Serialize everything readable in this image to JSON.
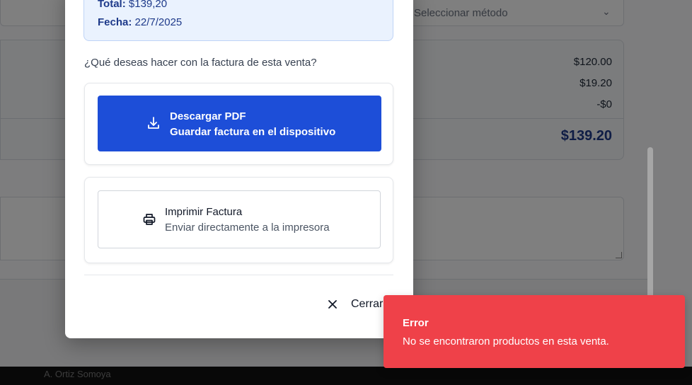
{
  "background": {
    "payment_select_placeholder": "Seleccionar método",
    "summary_rows": [
      "$120.00",
      "$19.20",
      "-$0"
    ],
    "summary_total": "$139.20",
    "footer_text": "A. Ortiz Somoya"
  },
  "modal": {
    "total_label": "Total:",
    "total_value": "$139,20",
    "date_label": "Fecha:",
    "date_value": "22/7/2025",
    "question": "¿Qué deseas hacer con la factura de esta venta?",
    "download": {
      "title": "Descargar PDF",
      "subtitle": "Guardar factura en el dispositivo",
      "icon": "download-icon"
    },
    "print": {
      "title": "Imprimir Factura",
      "subtitle": "Enviar directamente a la impresora",
      "icon": "printer-icon"
    },
    "close_label": "Cerrar",
    "close_icon": "close-icon"
  },
  "toast": {
    "title": "Error",
    "message": "No se encontraron productos en esta venta.",
    "color": "#ef4149"
  },
  "colors": {
    "primary": "#1d4ed8",
    "info_bg": "#eaf2fe",
    "info_text": "#1e3a8a"
  }
}
